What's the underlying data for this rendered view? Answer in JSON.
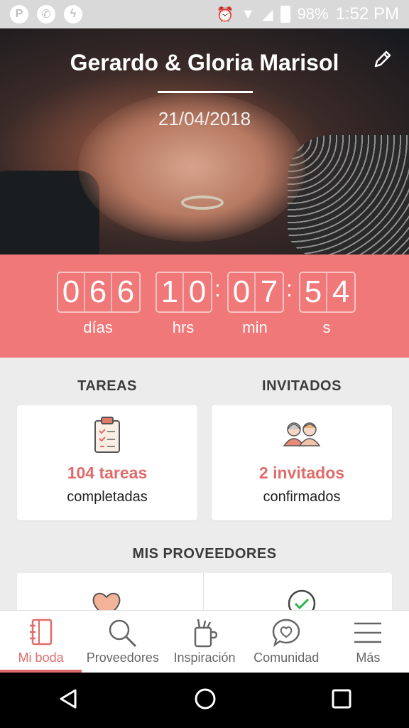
{
  "status_bar": {
    "apps": [
      "pinterest-icon",
      "whatsapp-icon",
      "messenger-icon"
    ],
    "battery": "98%",
    "time": "1:52 PM"
  },
  "hero": {
    "couple_name": "Gerardo & Gloria Marisol",
    "wedding_date": "21/04/2018"
  },
  "countdown": {
    "days": [
      "0",
      "6",
      "6"
    ],
    "hours": [
      "1",
      "0"
    ],
    "minutes": [
      "0",
      "7"
    ],
    "seconds": [
      "5",
      "4"
    ],
    "labels": {
      "days": "días",
      "hours": "hrs",
      "minutes": "min",
      "seconds": "s"
    }
  },
  "tareas": {
    "title": "TAREAS",
    "highlight": "104 tareas",
    "sub": "completadas"
  },
  "invitados": {
    "title": "INVITADOS",
    "highlight": "2 invitados",
    "sub": "confirmados"
  },
  "proveedores": {
    "title": "MIS PROVEEDORES"
  },
  "tabs": [
    {
      "label": "Mi boda",
      "icon": "notebook-icon",
      "active": true
    },
    {
      "label": "Proveedores",
      "icon": "search-icon",
      "active": false
    },
    {
      "label": "Inspiración",
      "icon": "inspiration-icon",
      "active": false
    },
    {
      "label": "Comunidad",
      "icon": "chat-heart-icon",
      "active": false
    },
    {
      "label": "Más",
      "icon": "menu-icon",
      "active": false
    }
  ],
  "colors": {
    "accent": "#e06b6b",
    "countdown_bg": "#f17878",
    "background": "#ececec"
  }
}
